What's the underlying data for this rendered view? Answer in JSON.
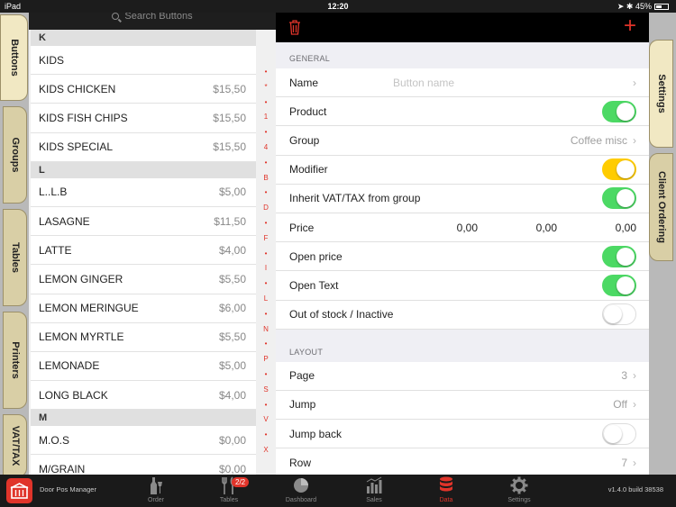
{
  "status_bar": {
    "device": "iPad",
    "time": "12:20",
    "battery": "45%"
  },
  "left_tabs": [
    "Buttons",
    "Groups",
    "Tables",
    "Printers",
    "VAT/TAX"
  ],
  "search": {
    "placeholder": "Search Buttons"
  },
  "sections": [
    {
      "header": "K",
      "items": [
        {
          "name": "KIDS",
          "price": ""
        },
        {
          "name": "KIDS CHICKEN",
          "price": "$15,50"
        },
        {
          "name": "KIDS FISH CHIPS",
          "price": "$15,50"
        },
        {
          "name": "KIDS SPECIAL",
          "price": "$15,50"
        }
      ]
    },
    {
      "header": "L",
      "items": [
        {
          "name": "L..L.B",
          "price": "$5,00"
        },
        {
          "name": "LASAGNE",
          "price": "$11,50"
        },
        {
          "name": "LATTE",
          "price": "$4,00"
        },
        {
          "name": "LEMON GINGER",
          "price": "$5,50"
        },
        {
          "name": "LEMON MERINGUE",
          "price": "$6,00"
        },
        {
          "name": "LEMON MYRTLE",
          "price": "$5,50"
        },
        {
          "name": "LEMONADE",
          "price": "$5,00"
        },
        {
          "name": "LONG BLACK",
          "price": "$4,00"
        }
      ]
    },
    {
      "header": "M",
      "items": [
        {
          "name": "M.O.S",
          "price": "$0,00"
        },
        {
          "name": "M/GRAIN",
          "price": "$0,00"
        }
      ]
    }
  ],
  "index": [
    "•",
    "*",
    "•",
    "1",
    "•",
    "4",
    "•",
    "B",
    "•",
    "D",
    "•",
    "F",
    "•",
    "I",
    "•",
    "L",
    "•",
    "N",
    "•",
    "P",
    "•",
    "S",
    "•",
    "V",
    "•",
    "X"
  ],
  "detail": {
    "general_label": "GENERAL",
    "name_label": "Name",
    "name_placeholder": "Button name",
    "product_label": "Product",
    "group_label": "Group",
    "group_value": "Coffee misc",
    "modifier_label": "Modifier",
    "inherit_label": "Inherit VAT/TAX from group",
    "price_label": "Price",
    "prices": [
      "0,00",
      "0,00",
      "0,00"
    ],
    "open_price_label": "Open price",
    "open_text_label": "Open Text",
    "out_of_stock_label": "Out of stock / Inactive",
    "layout_label": "LAYOUT",
    "page_label": "Page",
    "page_value": "3",
    "jump_label": "Jump",
    "jump_value": "Off",
    "jump_back_label": "Jump back",
    "row_label": "Row",
    "row_value": "7"
  },
  "toggles": {
    "product": true,
    "modifier": true,
    "inherit": true,
    "open_price": true,
    "open_text": true,
    "out_of_stock": false,
    "jump_back": false
  },
  "right_tabs": [
    "Settings",
    "Client Ordering"
  ],
  "bottom_bar": {
    "app_name": "Door Pos Manager",
    "tabs": [
      {
        "label": "Order",
        "icon": "bottle-icon"
      },
      {
        "label": "Tables",
        "icon": "cutlery-icon",
        "badge": "2/2"
      },
      {
        "label": "Dashboard",
        "icon": "pie-chart-icon"
      },
      {
        "label": "Sales",
        "icon": "bar-chart-icon"
      },
      {
        "label": "Data",
        "icon": "database-icon"
      },
      {
        "label": "Settings",
        "icon": "gear-icon"
      }
    ],
    "version": "v1.4.0 build 38538"
  },
  "colors": {
    "accent": "#e0342a",
    "toggle_on": "#4cd964",
    "toggle_modifier": "#ffcc00",
    "tab_bg": "#d9cfa6"
  }
}
